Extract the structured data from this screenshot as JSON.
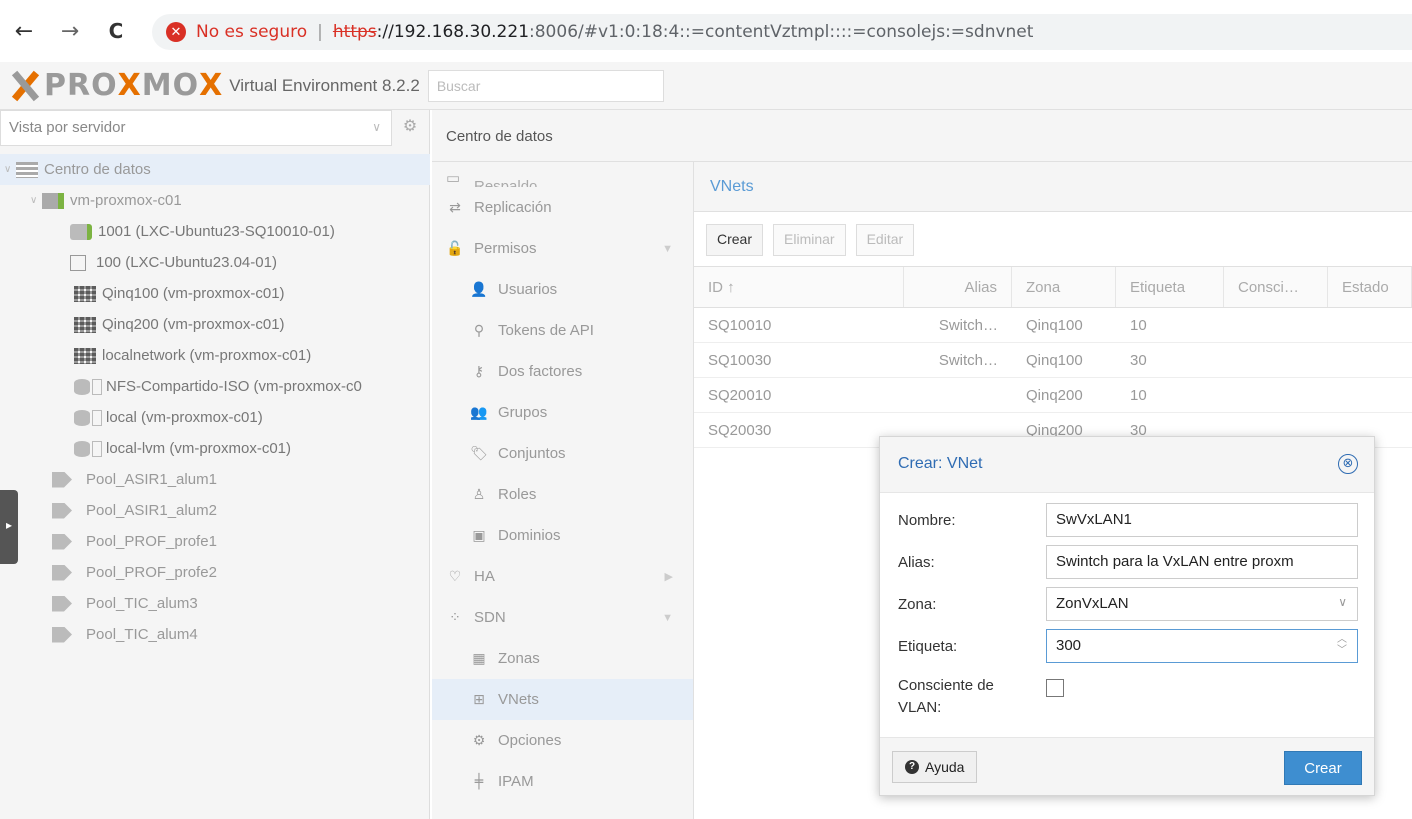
{
  "browser": {
    "back_icon": "←",
    "forward_icon": "→",
    "reload_icon": "C",
    "security_text": "No es seguro",
    "security_sep": "|",
    "url_proto": "https",
    "url_host": "://192.168.30.221",
    "url_rest": ":8006/#v1:0:18:4::=contentVztmpl::::=consolejs:=sdnvnet"
  },
  "header": {
    "logo_pro": "PRO",
    "logo_x": "X",
    "logo_mo": "MO",
    "version": "Virtual Environment 8.2.2",
    "search_placeholder": "Buscar"
  },
  "left": {
    "view": "Vista por servidor",
    "tree": [
      {
        "label": "Centro de datos",
        "icon": "datacenter-icon"
      },
      {
        "label": "vm-proxmox-c01",
        "icon": "node-icon"
      },
      {
        "label": "1001 (LXC-Ubuntu23-SQ10010-01)",
        "icon": "container-running-icon"
      },
      {
        "label": "100 (LXC-Ubuntu23.04-01)",
        "icon": "template-icon"
      },
      {
        "label": "Qinq100 (vm-proxmox-c01)",
        "icon": "sdn-zone-icon"
      },
      {
        "label": "Qinq200 (vm-proxmox-c01)",
        "icon": "sdn-zone-icon"
      },
      {
        "label": "localnetwork (vm-proxmox-c01)",
        "icon": "sdn-zone-icon"
      },
      {
        "label": "NFS-Compartido-ISO (vm-proxmox-c0",
        "icon": "storage-icon"
      },
      {
        "label": "local (vm-proxmox-c01)",
        "icon": "storage-icon"
      },
      {
        "label": "local-lvm (vm-proxmox-c01)",
        "icon": "storage-icon"
      },
      {
        "label": "Pool_ASIR1_alum1",
        "icon": "pool-icon"
      },
      {
        "label": "Pool_ASIR1_alum2",
        "icon": "pool-icon"
      },
      {
        "label": "Pool_PROF_profe1",
        "icon": "pool-icon"
      },
      {
        "label": "Pool_PROF_profe2",
        "icon": "pool-icon"
      },
      {
        "label": "Pool_TIC_alum3",
        "icon": "pool-icon"
      },
      {
        "label": "Pool_TIC_alum4",
        "icon": "pool-icon"
      }
    ]
  },
  "content_header": "Centro de datos",
  "menu": {
    "cut_label": "Respaldo",
    "items": [
      {
        "label": "Replicación",
        "glyph": "⇄"
      },
      {
        "label": "Permisos",
        "glyph": "🔓"
      },
      {
        "label": "Usuarios",
        "glyph": "👤"
      },
      {
        "label": "Tokens de API",
        "glyph": "⚲"
      },
      {
        "label": "Dos factores",
        "glyph": "⚷"
      },
      {
        "label": "Grupos",
        "glyph": "👥"
      },
      {
        "label": "Conjuntos",
        "glyph": "🏷"
      },
      {
        "label": "Roles",
        "glyph": "♙"
      },
      {
        "label": "Dominios",
        "glyph": "▣"
      },
      {
        "label": "HA",
        "glyph": "♡"
      },
      {
        "label": "SDN",
        "glyph": "⁘"
      },
      {
        "label": "Zonas",
        "glyph": "▦"
      },
      {
        "label": "VNets",
        "glyph": "⊞"
      },
      {
        "label": "Opciones",
        "glyph": "⚙"
      },
      {
        "label": "IPAM",
        "glyph": "╪"
      }
    ]
  },
  "vnets": {
    "title": "VNets",
    "buttons": {
      "create": "Crear",
      "delete": "Eliminar",
      "edit": "Editar"
    },
    "columns": [
      "ID ↑",
      "Alias",
      "Zona",
      "Etiqueta",
      "Consci…",
      "Estado"
    ],
    "rows": [
      [
        "SQ10010",
        "Switch…",
        "Qinq100",
        "10"
      ],
      [
        "SQ10030",
        "Switch…",
        "Qinq100",
        "30"
      ],
      [
        "SQ20010",
        "",
        "Qinq200",
        "10"
      ],
      [
        "SQ20030",
        "",
        "Qinq200",
        "30"
      ]
    ]
  },
  "dialog": {
    "title": "Crear: VNet",
    "close_icon": "⊗",
    "fields": {
      "name_label": "Nombre:",
      "name_value": "SwVxLAN1",
      "alias_label": "Alias:",
      "alias_value": "Swintch para la VxLAN entre proxm",
      "zone_label": "Zona:",
      "zone_value": "ZonVxLAN",
      "tag_label": "Etiqueta:",
      "tag_value": "300",
      "vlan_label_1": "Consciente de",
      "vlan_label_2": "VLAN:"
    },
    "help_label": "Ayuda",
    "create_label": "Crear"
  }
}
